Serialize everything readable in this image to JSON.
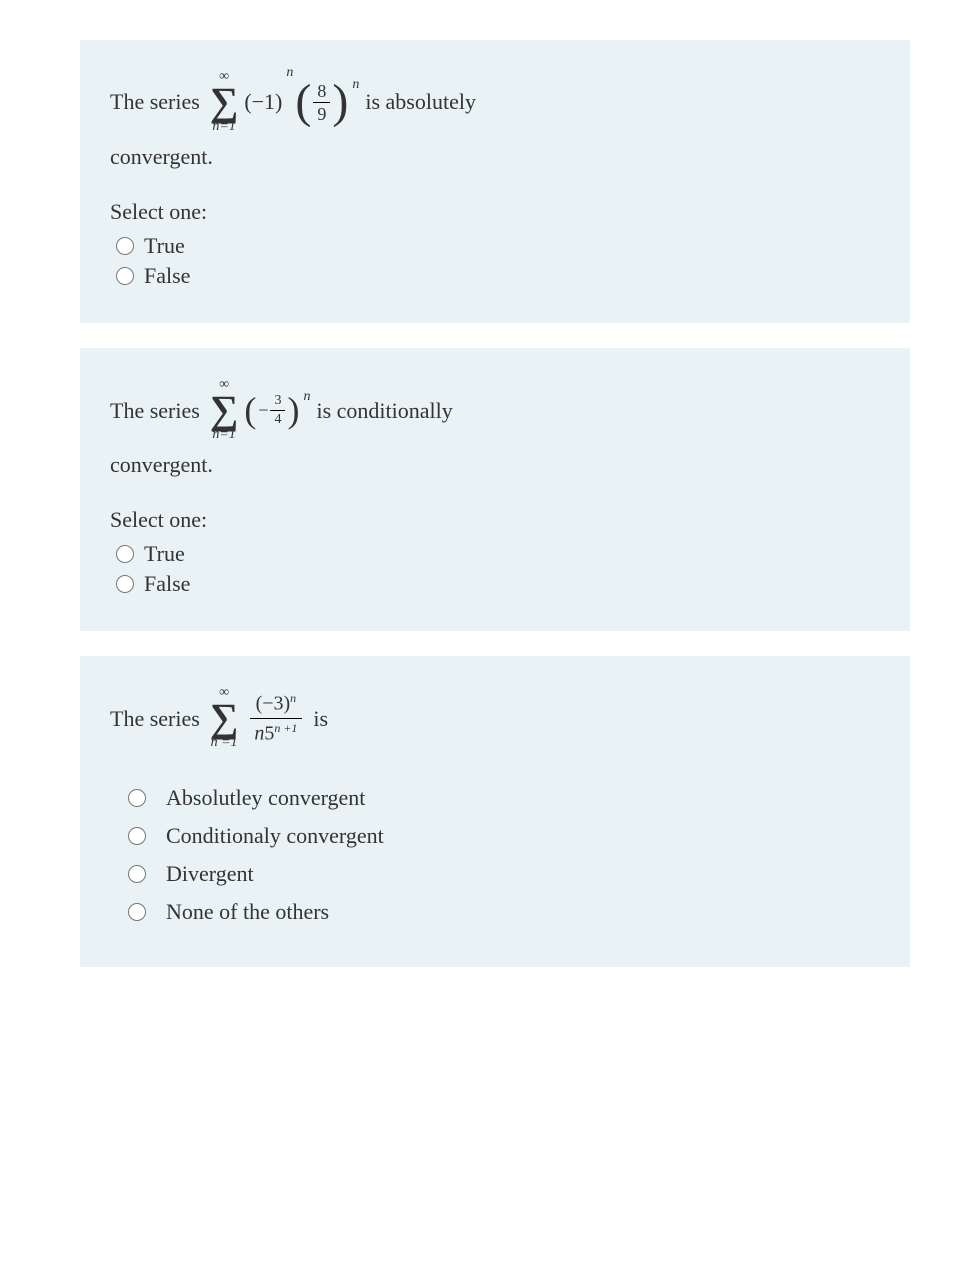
{
  "q1": {
    "text_before": "The series ",
    "sigma_top": "∞",
    "sigma_bot": "n=1",
    "term": "(−1)",
    "term_exp": "n",
    "frac_num": "8",
    "frac_den": "9",
    "frac_exp": "n",
    "text_after": " is absolutely",
    "text_line2": "convergent.",
    "prompt": "Select one:",
    "opt_true": "True",
    "opt_false": "False"
  },
  "q2": {
    "text_before": "The series ",
    "sigma_top": "∞",
    "sigma_bot": "n=1",
    "neg": "−",
    "frac_num": "3",
    "frac_den": "4",
    "frac_exp": "n",
    "text_after": " is conditionally",
    "text_line2": "convergent.",
    "prompt": "Select one:",
    "opt_true": "True",
    "opt_false": "False"
  },
  "q3": {
    "text_before": "The series ",
    "sigma_top": "∞",
    "sigma_bot": "n =1",
    "frac_num_a": "(−3)",
    "frac_num_exp": "n",
    "frac_den_a": "n",
    "frac_den_b": "5",
    "frac_den_exp": "n +1",
    "text_after": " is",
    "opt1": "Absolutley convergent",
    "opt2": "Conditionaly convergent",
    "opt3": "Divergent",
    "opt4": "None of the others"
  }
}
